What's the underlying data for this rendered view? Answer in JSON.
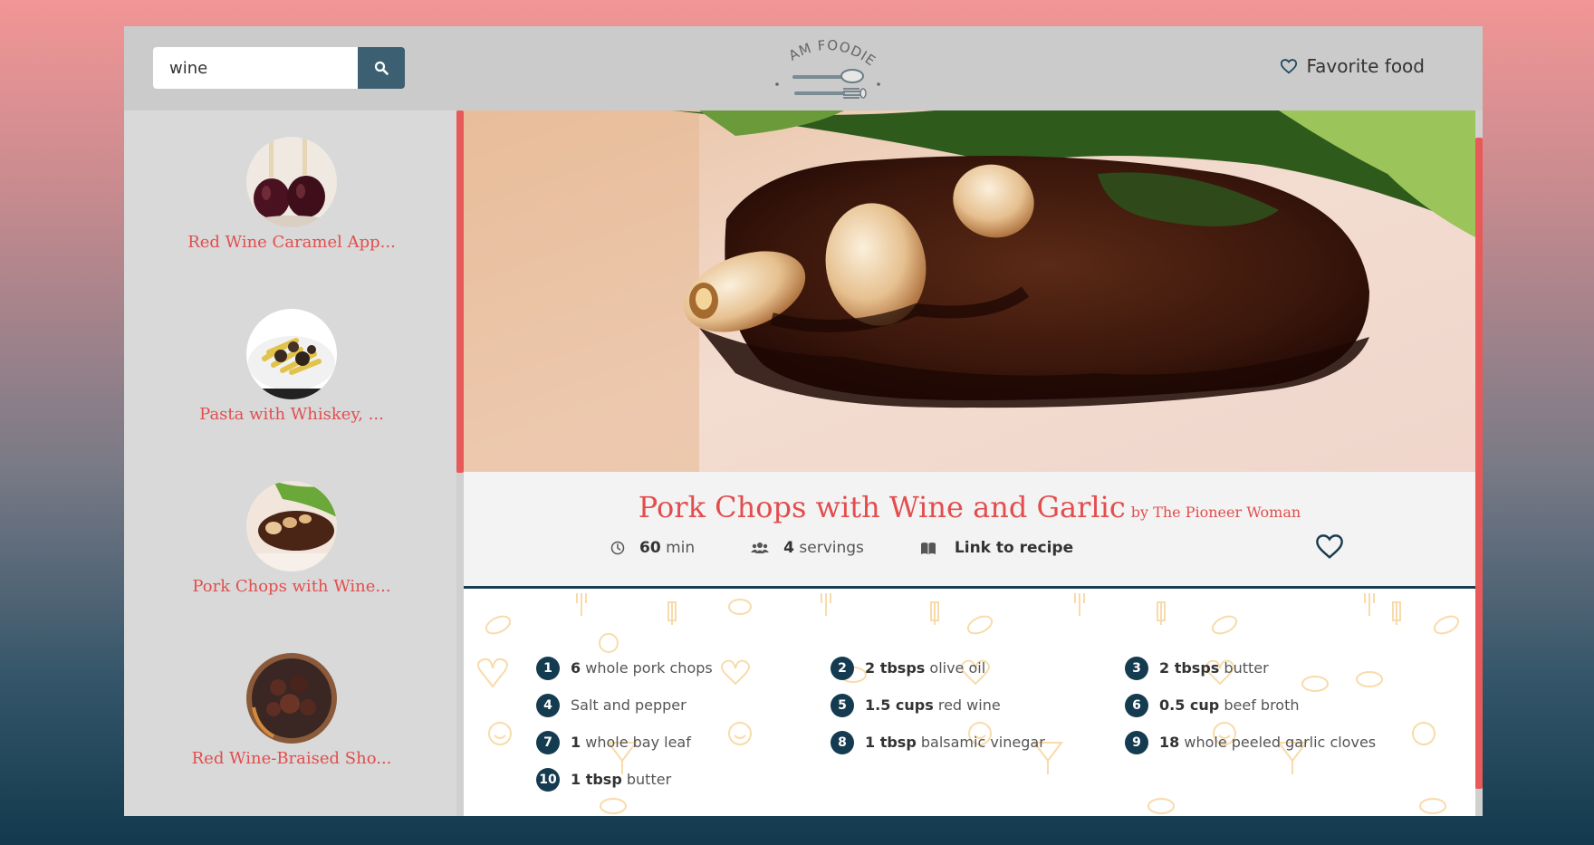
{
  "header": {
    "search_value": "wine",
    "search_placeholder": "",
    "logo_text": "I AM FOODIE",
    "favorites_label": "Favorite food"
  },
  "sidebar": {
    "items": [
      {
        "label": "Red Wine Caramel App...",
        "thumb": "red-wine-caramel-apples-image"
      },
      {
        "label": "Pasta with Whiskey, ...",
        "thumb": "pasta-with-whiskey-image"
      },
      {
        "label": "Pork Chops with Wine...",
        "thumb": "pork-chops-image"
      },
      {
        "label": "Red Wine-Braised Sho...",
        "thumb": "braised-short-ribs-image"
      }
    ]
  },
  "recipe": {
    "title": "Pork Chops with Wine and Garlic",
    "by": "by The Pioneer Woman",
    "time_value": "60",
    "time_unit": "min",
    "servings_value": "4",
    "servings_unit": "servings",
    "link_label": "Link to recipe",
    "ingredients": [
      {
        "num": "1",
        "qty": "6",
        "text": "whole pork chops"
      },
      {
        "num": "2",
        "qty": "2 tbsps",
        "text": "olive oil"
      },
      {
        "num": "3",
        "qty": "2 tbsps",
        "text": "butter"
      },
      {
        "num": "4",
        "qty": "",
        "text": "Salt and pepper"
      },
      {
        "num": "5",
        "qty": "1.5 cups",
        "text": "red wine"
      },
      {
        "num": "6",
        "qty": "0.5 cup",
        "text": "beef broth"
      },
      {
        "num": "7",
        "qty": "1",
        "text": "whole bay leaf"
      },
      {
        "num": "8",
        "qty": "1 tbsp",
        "text": "balsamic vinegar"
      },
      {
        "num": "9",
        "qty": "18",
        "text": "whole peeled garlic cloves"
      },
      {
        "num": "10",
        "qty": "1 tbsp",
        "text": "butter"
      }
    ]
  },
  "colors": {
    "accent": "#e34d4d",
    "dark": "#143b50",
    "search_button": "#3c5f72"
  },
  "icons": {
    "search": "search-icon",
    "heart": "heart-icon",
    "clock": "clock-icon",
    "users": "users-icon",
    "book": "book-icon"
  }
}
